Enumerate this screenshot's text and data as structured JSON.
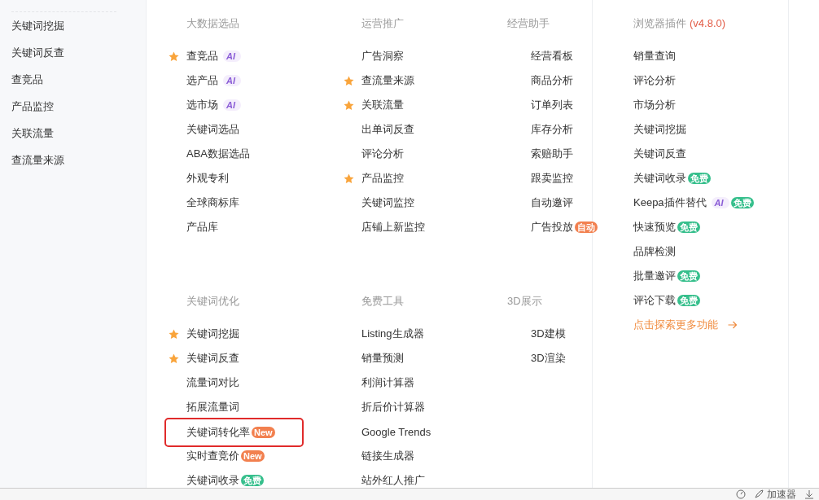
{
  "sidebar": {
    "items": [
      {
        "label": "关键词挖掘"
      },
      {
        "label": "关键词反查"
      },
      {
        "label": "查竞品"
      },
      {
        "label": "产品监控"
      },
      {
        "label": "关联流量"
      },
      {
        "label": "查流量来源"
      }
    ]
  },
  "menu": {
    "sections": [
      {
        "title": "大数据选品",
        "items": [
          {
            "label": "查竞品",
            "starred": true,
            "badges": [
              {
                "kind": "ai",
                "text": "AI"
              }
            ]
          },
          {
            "label": "选产品",
            "starred": false,
            "badges": [
              {
                "kind": "ai",
                "text": "AI"
              }
            ]
          },
          {
            "label": "选市场",
            "starred": false,
            "badges": [
              {
                "kind": "ai",
                "text": "AI"
              }
            ]
          },
          {
            "label": "关键词选品",
            "starred": false
          },
          {
            "label": "ABA数据选品",
            "starred": false
          },
          {
            "label": "外观专利",
            "starred": false
          },
          {
            "label": "全球商标库",
            "starred": false
          },
          {
            "label": "产品库",
            "starred": false
          }
        ]
      },
      {
        "title": "运营推广",
        "items": [
          {
            "label": "广告洞察",
            "starred": false
          },
          {
            "label": "查流量来源",
            "starred": true
          },
          {
            "label": "关联流量",
            "starred": true
          },
          {
            "label": "出单词反查",
            "starred": false
          },
          {
            "label": "评论分析",
            "starred": false
          },
          {
            "label": "产品监控",
            "starred": true
          },
          {
            "label": "关键词监控",
            "starred": false
          },
          {
            "label": "店铺上新监控",
            "starred": false
          }
        ]
      },
      {
        "title": "经营助手",
        "items": [
          {
            "label": "经营看板",
            "starred": false
          },
          {
            "label": "商品分析",
            "starred": false
          },
          {
            "label": "订单列表",
            "starred": false
          },
          {
            "label": "库存分析",
            "starred": false
          },
          {
            "label": "索赔助手",
            "starred": false
          },
          {
            "label": "跟卖监控",
            "starred": false
          },
          {
            "label": "自动邀评",
            "starred": false
          },
          {
            "label": "广告投放",
            "starred": false,
            "badges": [
              {
                "kind": "hot",
                "text": "自动"
              }
            ]
          }
        ]
      },
      {
        "title": "关键词优化",
        "items": [
          {
            "label": "关键词挖掘",
            "starred": true
          },
          {
            "label": "关键词反查",
            "starred": true
          },
          {
            "label": "流量词对比",
            "starred": false
          },
          {
            "label": "拓展流量词",
            "starred": false
          },
          {
            "label": "关键词转化率",
            "starred": false,
            "highlighted": true,
            "badges": [
              {
                "kind": "hot",
                "text": "New"
              }
            ]
          },
          {
            "label": "实时查竞价",
            "starred": false,
            "badges": [
              {
                "kind": "hot",
                "text": "New"
              }
            ]
          },
          {
            "label": "关键词收录",
            "starred": false,
            "badges": [
              {
                "kind": "free",
                "text": "免费"
              }
            ]
          }
        ]
      },
      {
        "title": "免费工具",
        "items": [
          {
            "label": "Listing生成器",
            "starred": false
          },
          {
            "label": "销量预测",
            "starred": false
          },
          {
            "label": "利润计算器",
            "starred": false
          },
          {
            "label": "折后价计算器",
            "starred": false
          },
          {
            "label": "Google Trends",
            "starred": false
          },
          {
            "label": "链接生成器",
            "starred": false
          },
          {
            "label": "站外红人推广",
            "starred": false
          }
        ]
      },
      {
        "title": "3D展示",
        "items": [
          {
            "label": "3D建模",
            "starred": false
          },
          {
            "label": "3D渲染",
            "starred": false
          }
        ]
      }
    ]
  },
  "plugin": {
    "title": "浏览器插件",
    "version": "(v4.8.0)",
    "items": [
      {
        "label": "销量查询"
      },
      {
        "label": "评论分析"
      },
      {
        "label": "市场分析"
      },
      {
        "label": "关键词挖掘"
      },
      {
        "label": "关键词反查"
      },
      {
        "label": "关键词收录",
        "badges": [
          {
            "kind": "free",
            "text": "免费"
          }
        ]
      },
      {
        "label": "Keepa插件替代",
        "badges": [
          {
            "kind": "ai",
            "text": "AI"
          },
          {
            "kind": "free",
            "text": "免费"
          }
        ]
      },
      {
        "label": "快速预览",
        "badges": [
          {
            "kind": "free",
            "text": "免费"
          }
        ]
      },
      {
        "label": "品牌检测"
      },
      {
        "label": "批量邀评",
        "badges": [
          {
            "kind": "free",
            "text": "免费"
          }
        ]
      },
      {
        "label": "评论下载",
        "badges": [
          {
            "kind": "free",
            "text": "免费"
          }
        ]
      }
    ],
    "more_link": "点击探索更多功能"
  },
  "status_bar": {
    "accelerator": "加速器"
  }
}
